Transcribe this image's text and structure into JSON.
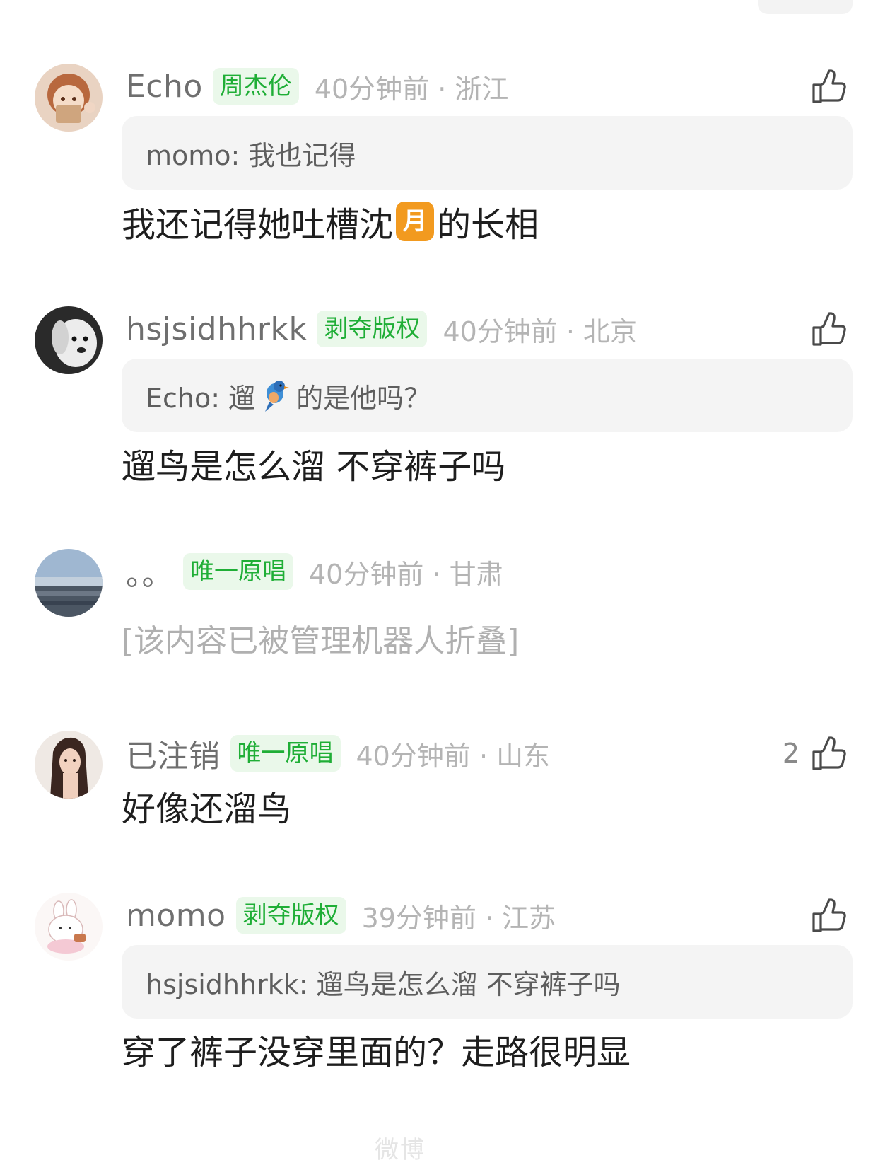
{
  "colors": {
    "badge_bg": "#eaf8ea",
    "badge_text": "#1fae36",
    "meta": "#b4b4b4",
    "quote_bg": "#f4f4f4",
    "moon_emoji": "#f29a1f"
  },
  "comments": [
    {
      "username": "Echo",
      "badge": "周杰伦",
      "time": "40分钟前",
      "location": "浙江",
      "like_count": "",
      "quote": "momo: 我也记得",
      "text_before": "我还记得她吐槽沈",
      "emoji": "月",
      "text_after": "的长相"
    },
    {
      "username": "hsjsidhhrkk",
      "badge": "剥夺版权",
      "time": "40分钟前",
      "location": "北京",
      "like_count": "",
      "quote_before": "Echo: 遛",
      "quote_icon": "bluebird-emoji-icon",
      "quote_after": "的是他吗？",
      "text": "遛鸟是怎么溜 不穿裤子吗"
    },
    {
      "username": "。。",
      "badge": "唯一原唱",
      "time": "40分钟前",
      "location": "甘肃",
      "folded_text": "[该内容已被管理机器人折叠]"
    },
    {
      "username": "已注销",
      "badge": "唯一原唱",
      "time": "40分钟前",
      "location": "山东",
      "like_count": "2",
      "text": "好像还溜鸟"
    },
    {
      "username": "momo",
      "badge": "剥夺版权",
      "time": "39分钟前",
      "location": "江苏",
      "like_count": "",
      "quote": "hsjsidhhrkk: 遛鸟是怎么溜 不穿裤子吗",
      "text": "穿了裤子没穿里面的？走路很明显"
    }
  ],
  "separator": " · ",
  "watermark": "微博"
}
